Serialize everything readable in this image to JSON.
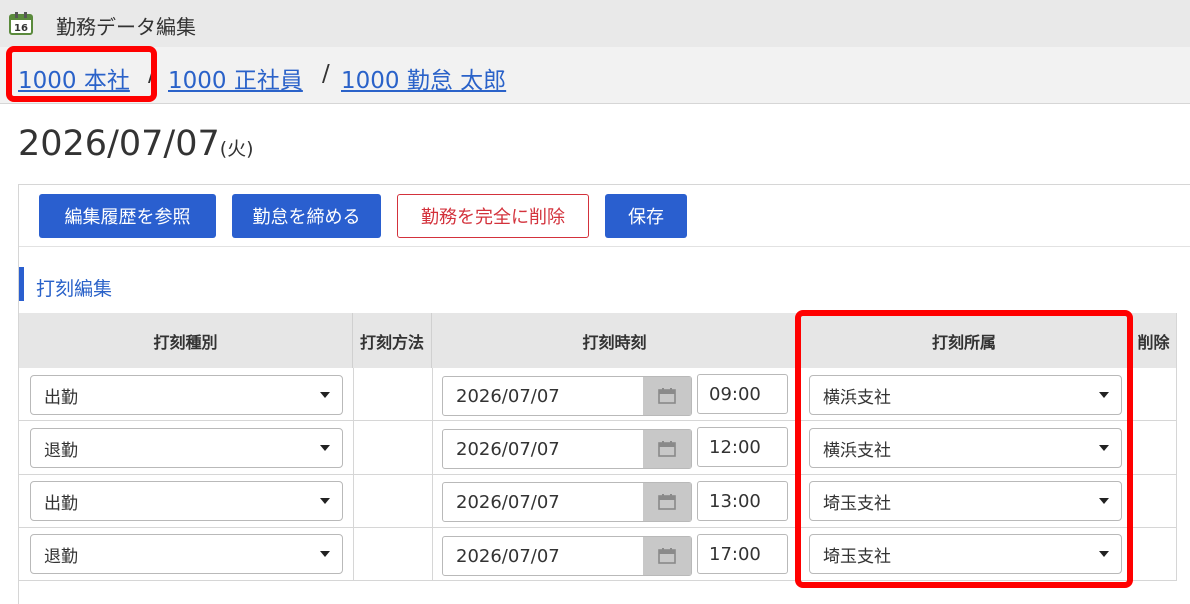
{
  "app": {
    "title": "勤務データ編集",
    "icon": "calendar-icon"
  },
  "breadcrumb": {
    "company": "1000 本社",
    "employment": "1000 正社員",
    "employee": "1000 勤怠 太郎",
    "separator": "/"
  },
  "date": {
    "value": "2026/07/07",
    "weekday": "(火)"
  },
  "toolbar": {
    "history": "編集履歴を参照",
    "close": "勤怠を締める",
    "delete": "勤務を完全に削除",
    "save": "保存"
  },
  "section": {
    "title": "打刻編集"
  },
  "table": {
    "headers": {
      "type": "打刻種別",
      "method": "打刻方法",
      "time": "打刻時刻",
      "affiliation": "打刻所属",
      "delete": "削除"
    },
    "rows": [
      {
        "type": "出勤",
        "date": "2026/07/07",
        "time": "09:00",
        "affiliation": "横浜支社"
      },
      {
        "type": "退勤",
        "date": "2026/07/07",
        "time": "12:00",
        "affiliation": "横浜支社"
      },
      {
        "type": "出勤",
        "date": "2026/07/07",
        "time": "13:00",
        "affiliation": "埼玉支社"
      },
      {
        "type": "退勤",
        "date": "2026/07/07",
        "time": "17:00",
        "affiliation": "埼玉支社"
      }
    ]
  },
  "colors": {
    "accent": "#2a5fcf",
    "danger": "#d3323c",
    "highlight": "#ff0000"
  }
}
